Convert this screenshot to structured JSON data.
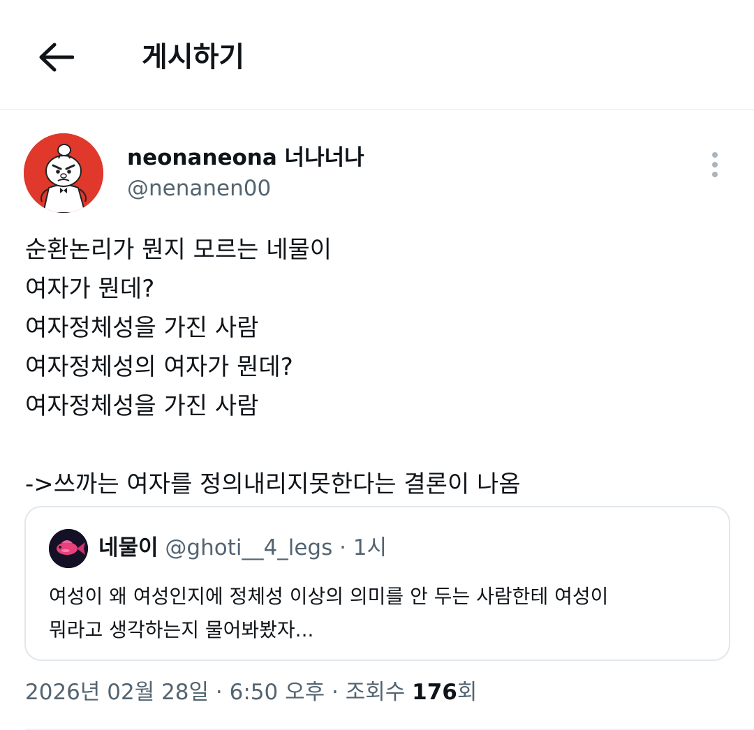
{
  "header": {
    "back_icon": "arrow-left-icon",
    "title": "게시하기"
  },
  "post": {
    "author": {
      "name": "neonaneona 너나너나",
      "handle": "@nenanen00",
      "avatar_icon": "little-my-avatar"
    },
    "more_icon": "more-vertical-icon",
    "lines": [
      "순환논리가 뭔지 모르는 네물이",
      "여자가 뭔데?",
      "여자정체성을 가진 사람",
      "여자정체성의 여자가 뭔데?",
      "여자정체성을 가진 사람",
      "",
      "->쓰까는 여자를 정의내리지못한다는 결론이 나옴"
    ],
    "quote": {
      "name": "네물이",
      "handle": "@ghoti__4_legs",
      "separator": " · ",
      "time": "1시",
      "avatar_icon": "fish-avatar",
      "lines": [
        "여성이 왜 여성인지에 정체성 이상의 의미를 안 두는 사람한테 여성이",
        "뭐라고 생각하는지 물어봐봤자..."
      ]
    },
    "meta": {
      "date": "2026년 02월 28일",
      "separator": " · ",
      "time": "6:50 오후",
      "views_label": "조회수 ",
      "views_count": "176",
      "views_suffix": "회"
    }
  },
  "colors": {
    "text": "#0f1419",
    "secondary": "#536471",
    "border": "#e1e8ed",
    "avatar_bg": "#e0382a"
  }
}
